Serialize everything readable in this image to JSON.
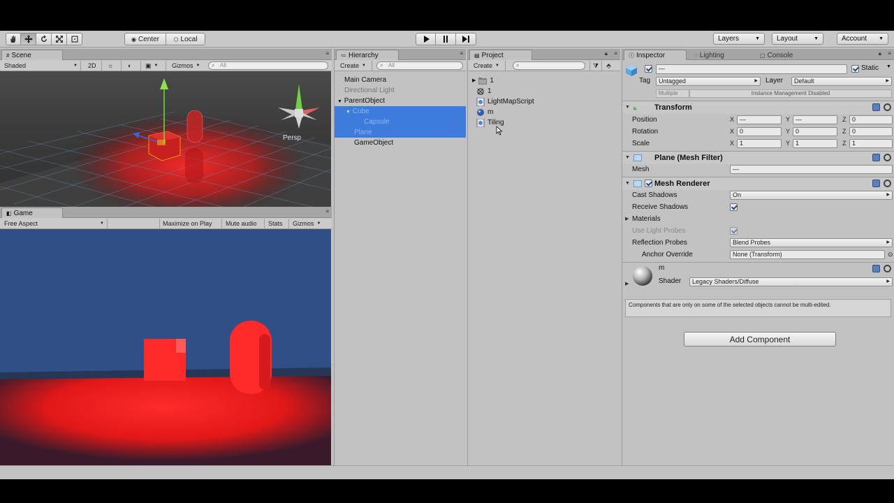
{
  "toolbar": {
    "pivot_label": "Center",
    "space_label": "Local",
    "layers_label": "Layers",
    "layout_label": "Layout",
    "account_label": "Account"
  },
  "scene": {
    "tab_label": "Scene",
    "shading_label": "Shaded",
    "mode_2d_label": "2D",
    "gizmos_label": "Gizmos",
    "search_placeholder": "All",
    "persp_label": "Persp"
  },
  "game": {
    "tab_label": "Game",
    "aspect_label": "Free Aspect",
    "maximize_label": "Maximize on Play",
    "mute_label": "Mute audio",
    "stats_label": "Stats",
    "gizmos_label": "Gizmos"
  },
  "hierarchy": {
    "tab_label": "Hierarchy",
    "create_label": "Create",
    "search_placeholder": "All",
    "items": [
      {
        "label": "Main Camera"
      },
      {
        "label": "Directional Light"
      },
      {
        "label": "ParentObject"
      },
      {
        "label": "Cube"
      },
      {
        "label": "Capsule"
      },
      {
        "label": "Plane"
      },
      {
        "label": "GameObject"
      }
    ]
  },
  "project": {
    "tab_label": "Project",
    "create_label": "Create",
    "items": [
      {
        "label": "1",
        "icon": "scene-folder-icon"
      },
      {
        "label": "1",
        "icon": "lightmap-asset-icon"
      },
      {
        "label": "LightMapScript",
        "icon": "csharp-script-icon"
      },
      {
        "label": "m",
        "icon": "material-icon"
      },
      {
        "label": "Tiling",
        "icon": "csharp-script-icon"
      }
    ]
  },
  "inspector": {
    "tab_label": "Inspector",
    "lighting_tab_label": "Lighting",
    "console_tab_label": "Console",
    "name_value": "—",
    "static_label": "Static",
    "tag_label": "Tag",
    "tag_value": "Untagged",
    "layer_label": "Layer",
    "layer_value": "Default",
    "multiple_label": "Multiple",
    "instance_label": "Instance Management Disabled",
    "transform": {
      "title": "Transform",
      "position_label": "Position",
      "rotation_label": "Rotation",
      "scale_label": "Scale",
      "axis_x": "X",
      "axis_y": "Y",
      "axis_z": "Z",
      "position": {
        "x": "—",
        "y": "—",
        "z": "0"
      },
      "rotation": {
        "x": "0",
        "y": "0",
        "z": "0"
      },
      "scale": {
        "x": "1",
        "y": "1",
        "z": "1"
      }
    },
    "mesh_filter": {
      "title": "Plane (Mesh Filter)",
      "mesh_label": "Mesh",
      "mesh_value": "—"
    },
    "mesh_renderer": {
      "title": "Mesh Renderer",
      "cast_shadows_label": "Cast Shadows",
      "cast_shadows_value": "On",
      "receive_shadows_label": "Receive Shadows",
      "materials_label": "Materials",
      "use_light_probes_label": "Use Light Probes",
      "reflection_probes_label": "Reflection Probes",
      "reflection_probes_value": "Blend Probes",
      "anchor_override_label": "Anchor Override",
      "anchor_override_value": "None (Transform)"
    },
    "material": {
      "name": "m",
      "shader_label": "Shader",
      "shader_value": "Legacy Shaders/Diffuse"
    },
    "info_text": "Components that are only on some of the selected objects cannot be multi-edited.",
    "add_component_label": "Add Component"
  },
  "colors": {
    "selection": "#3d7bdc",
    "game_sky": "#2f4f86",
    "red_light": "#ff2a2a",
    "panel_bg": "#c2c2c2"
  }
}
